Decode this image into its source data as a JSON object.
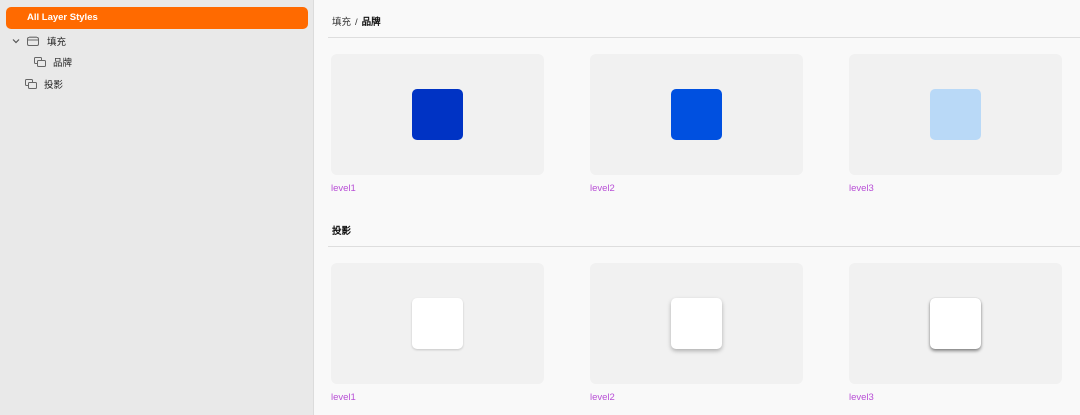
{
  "sidebar": {
    "selected_label": "All Layer Styles",
    "items": [
      {
        "label": "填充",
        "icon": "folder-icon",
        "expanded": true
      },
      {
        "label": "品牌",
        "icon": "layer-style-icon"
      },
      {
        "label": "投影",
        "icon": "layer-style-icon"
      }
    ]
  },
  "main": {
    "breadcrumb": {
      "parent": "填充",
      "separator": "/",
      "current": "品牌"
    },
    "fill_cards": [
      {
        "label": "level1",
        "color": "#0033c4"
      },
      {
        "label": "level2",
        "color": "#0050e0"
      },
      {
        "label": "level3",
        "color": "#b9d9f7"
      }
    ],
    "shadow_section_title": "投影",
    "shadow_cards": [
      {
        "label": "level1"
      },
      {
        "label": "level2"
      },
      {
        "label": "level3"
      }
    ]
  },
  "colors": {
    "accent": "#ff6a00",
    "label": "#b84fd6"
  }
}
